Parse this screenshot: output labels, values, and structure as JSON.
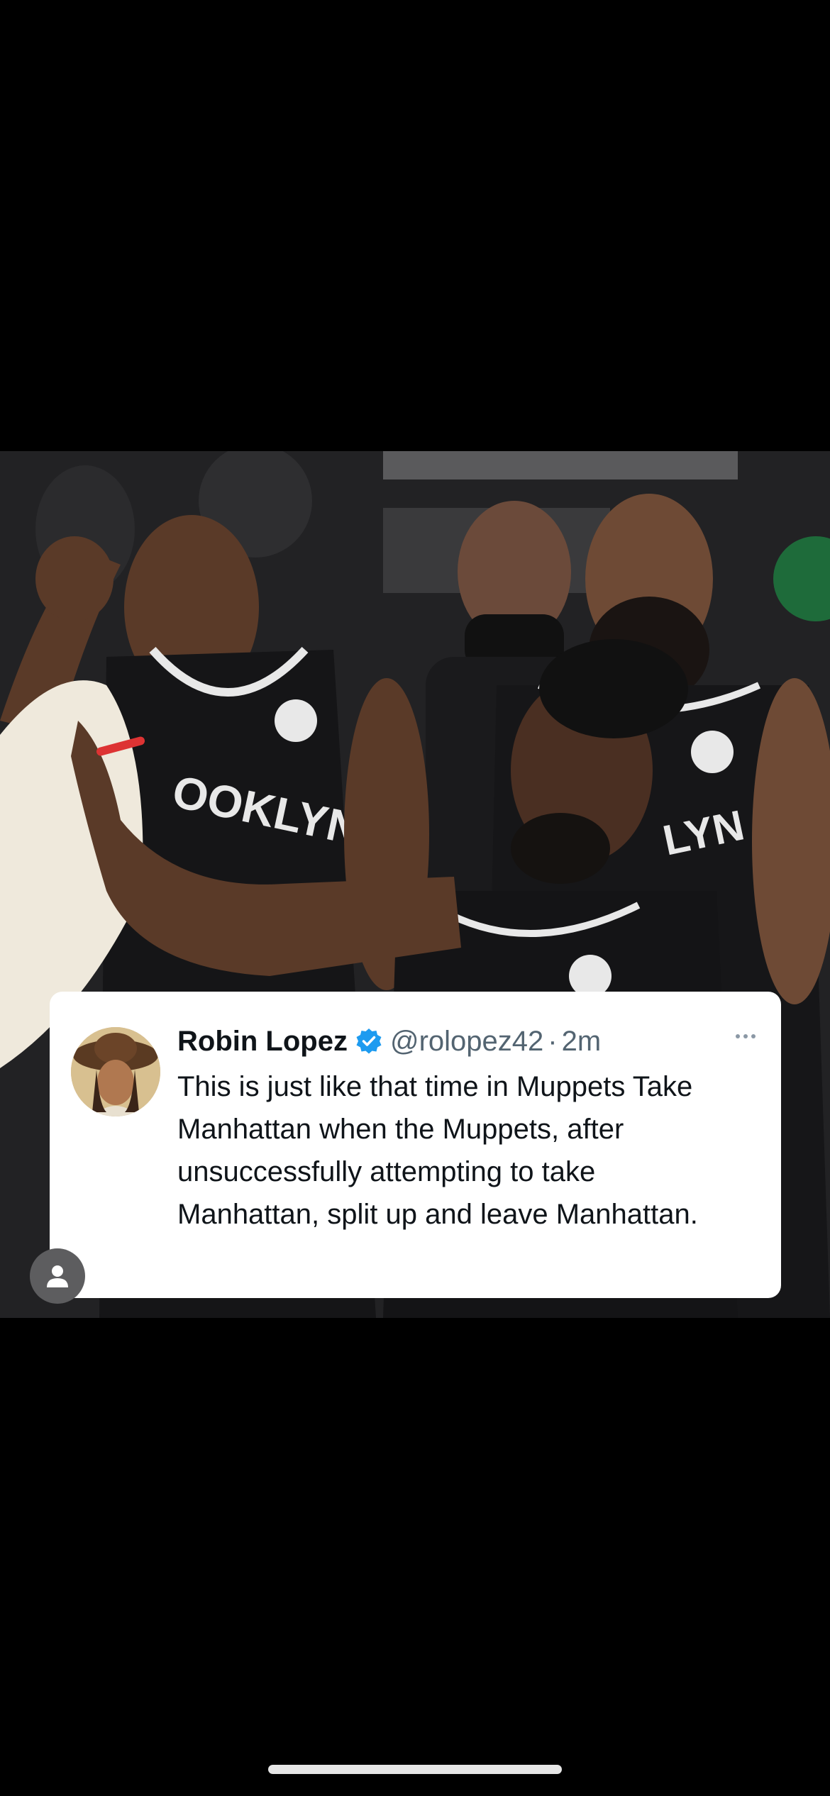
{
  "tweet": {
    "display_name": "Robin Lopez",
    "verified_icon": "verified-badge-icon",
    "handle": "@rolopez42",
    "separator": "·",
    "time": "2m",
    "text": "This is just like that time in Muppets Take Manhattan when the Muppets, after unsuccessfully attempting to take Manhattan, split up and leave Manhattan.",
    "more_icon": "more-options-icon"
  },
  "photo": {
    "jersey_text_left": "OOKLYN",
    "jersey_text_right": "LYN"
  },
  "colors": {
    "background": "#000000",
    "card": "#ffffff",
    "verified": "#1d9bf0",
    "secondary_text": "#536471"
  }
}
